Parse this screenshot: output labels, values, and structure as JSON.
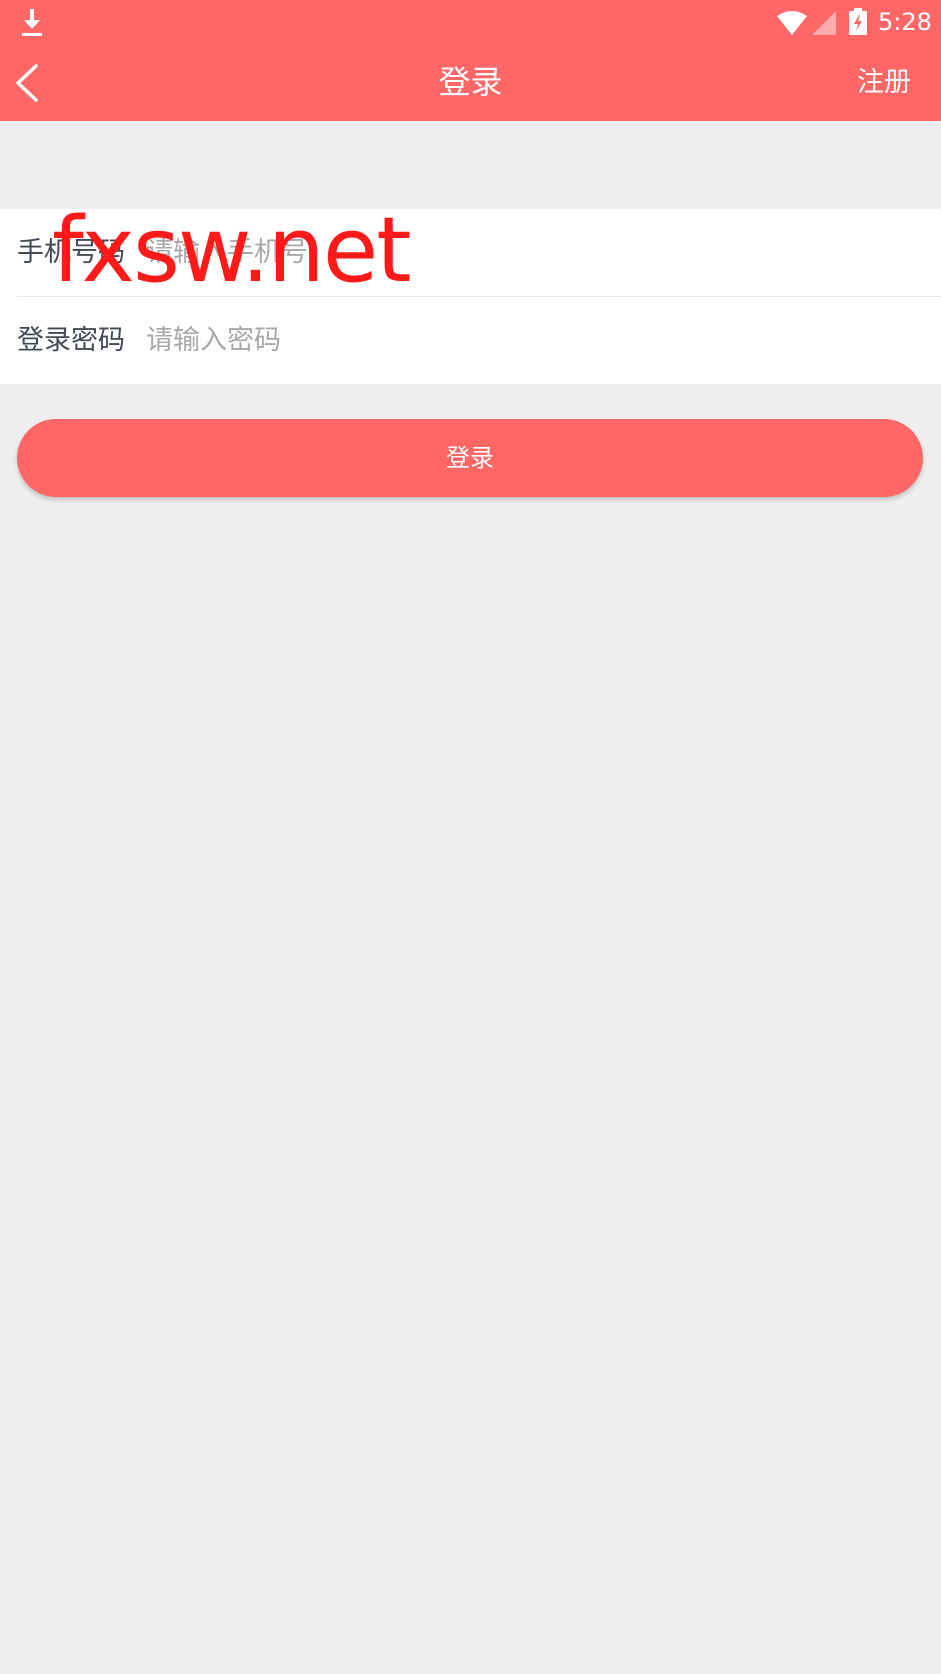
{
  "status_bar": {
    "time": "5:28",
    "icons": [
      "download-icon",
      "wifi-icon",
      "signal-icon",
      "battery-charging-icon"
    ]
  },
  "nav": {
    "back_icon": "chevron-left-icon",
    "title": "登录",
    "register_label": "注册"
  },
  "form": {
    "phone": {
      "label": "手机号码",
      "placeholder": "请输入手机号",
      "value": ""
    },
    "password": {
      "label": "登录密码",
      "placeholder": "请输入密码",
      "value": ""
    }
  },
  "login_button": {
    "label": "登录"
  },
  "watermark": {
    "text": "fxsw.net"
  },
  "colors": {
    "accent": "#ff6666",
    "background": "#eeeeee",
    "watermark": "#ff1a1a",
    "label": "#444a55",
    "placeholder": "#a8a8a8"
  }
}
